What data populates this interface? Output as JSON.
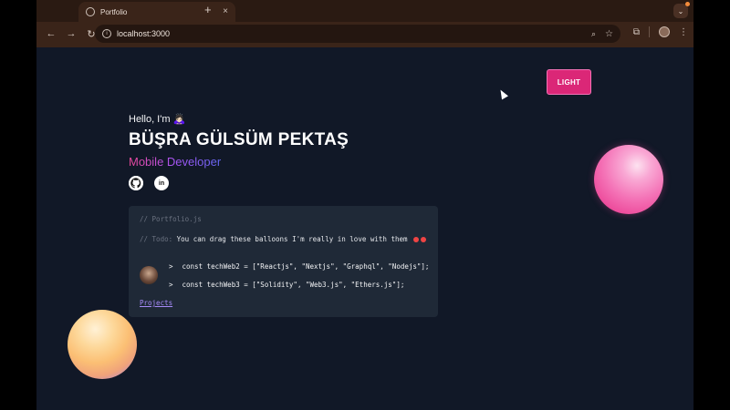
{
  "browser": {
    "tab_title": "Portfolio",
    "tab_close": "×",
    "new_tab": "+",
    "url": "localhost:3000",
    "icons": [
      "globe-icon",
      "back-icon",
      "forward-icon",
      "reload-icon",
      "info-icon",
      "zoom-icon",
      "star-icon",
      "extensions-icon",
      "profile-icon",
      "menu-icon",
      "tab-search-icon"
    ]
  },
  "page": {
    "theme_button": "LIGHT",
    "greeting": "Hello, I'm 🙇🏻‍♀️",
    "name": "BÜŞRA GÜLSÜM PEKTAŞ",
    "role": "Mobile Developer",
    "socials": [
      "github-icon",
      "linkedin-icon"
    ],
    "code": {
      "file_comment": "// Portfolio.js",
      "todo_key": "// Todo:",
      "todo_text": " You can drag these balloons I'm really in love with them",
      "line1": "const techWeb2 = [\"Reactjs\", \"Nextjs\", \"Graphql\", \"Nodejs\"];",
      "line2": "const techWeb3 = [\"Solidity\", \"Web3.js\", \"Ethers.js\"];",
      "prompt": ">",
      "projects_link": "Projects"
    }
  },
  "colors": {
    "page_bg": "#111827",
    "card_bg": "#1f2937",
    "accent": "#db2777",
    "link": "#a78bfa"
  }
}
